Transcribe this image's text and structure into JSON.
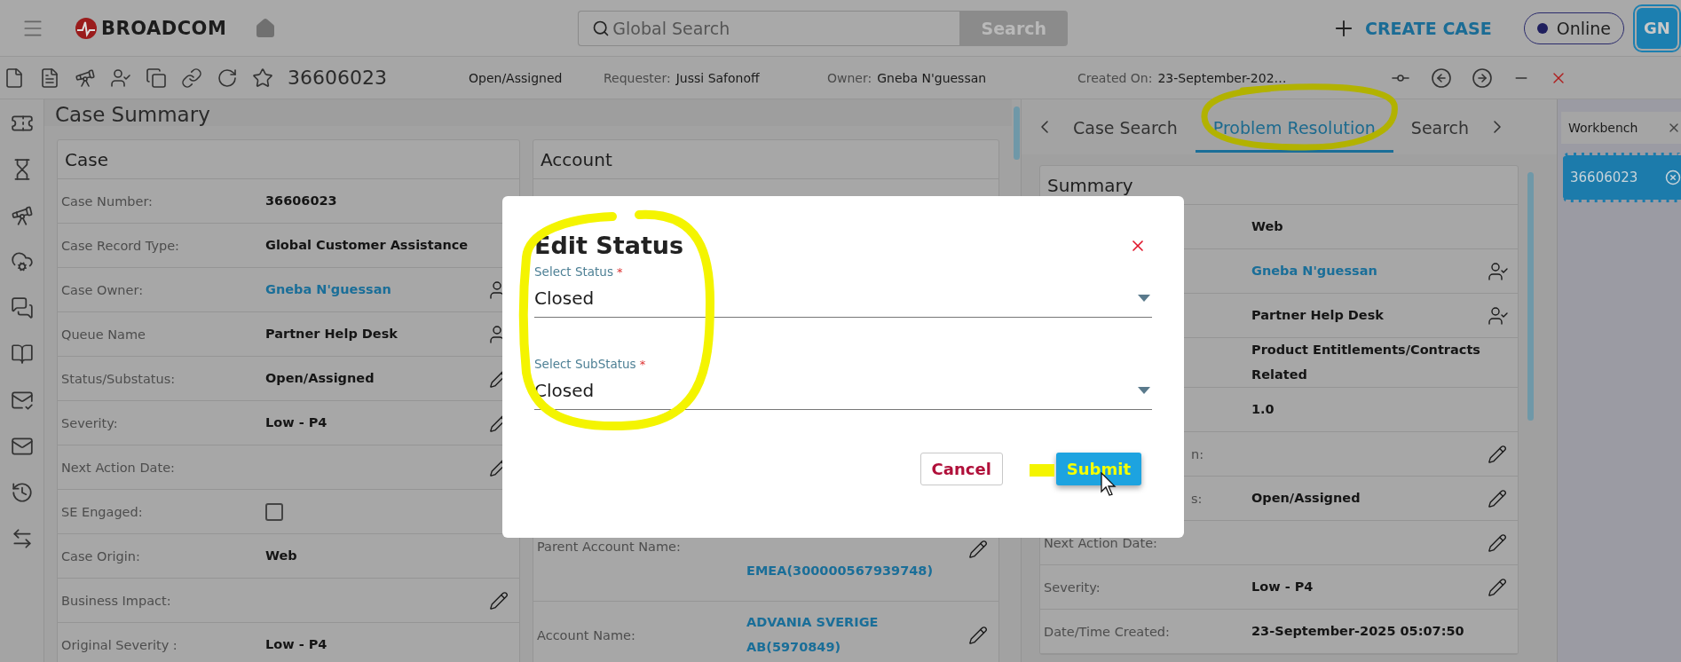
{
  "topbar": {
    "brand": "BROADCOM",
    "search": {
      "placeholder": "Global Search"
    },
    "search_button": "Search",
    "create_case": "CREATE CASE",
    "presence": "Online",
    "avatar": "GN"
  },
  "case_bar": {
    "case_number": "36606023",
    "status": "Open/Assigned",
    "fields": [
      {
        "label": "Requester:",
        "value": "Jussi Safonoff"
      },
      {
        "label": "Owner:",
        "value": "Gneba N'guessan"
      },
      {
        "label": "Created On:",
        "value": "23-September-202…"
      }
    ]
  },
  "case_summary": {
    "title": "Case Summary",
    "case_card": {
      "title": "Case",
      "rows": [
        {
          "kind": "text",
          "label": "Case Number:",
          "value": "36606023"
        },
        {
          "kind": "text",
          "label": "Case Record Type:",
          "value": "Global Customer Assistance"
        },
        {
          "kind": "link",
          "label": "Case Owner:",
          "value": "Gneba N'guessan",
          "action": {
            "kind": "reassign"
          }
        },
        {
          "kind": "text",
          "label": "Queue Name",
          "value": "Partner Help Desk",
          "action": {
            "kind": "reassign"
          }
        },
        {
          "kind": "text",
          "label": "Status/Substatus:",
          "value": "Open/Assigned",
          "action": {
            "kind": "edit"
          }
        },
        {
          "kind": "text",
          "label": "Severity:",
          "value": "Low - P4",
          "action": {
            "kind": "edit"
          }
        },
        {
          "kind": "text",
          "label": "Next Action Date:",
          "action": {
            "kind": "edit"
          }
        },
        {
          "kind": "checkbox",
          "label": "SE Engaged:",
          "checked": false
        },
        {
          "kind": "text",
          "label": "Case Origin:",
          "value": "Web"
        },
        {
          "kind": "text",
          "label": "Business Impact:",
          "action": {
            "kind": "edit"
          }
        },
        {
          "kind": "text",
          "label": "Original Severity :",
          "value": "Low - P4"
        }
      ]
    },
    "account_card": {
      "title": "Account",
      "rows": [
        {
          "kind": "link",
          "label": "Parent Account Name:",
          "value": "EMEA(300000567939748)",
          "action": {
            "kind": "edit"
          }
        },
        {
          "kind": "link",
          "label": "Account Name:",
          "value": "ADVANIA SVERIGE AB(5970849)",
          "action": {
            "kind": "edit"
          }
        }
      ]
    }
  },
  "right_panel": {
    "tabs": [
      {
        "label": "Case Search",
        "selected": false
      },
      {
        "label": "Problem Resolution",
        "selected": true
      },
      {
        "label": "Search",
        "selected": false
      }
    ],
    "summary": {
      "title": "Summary",
      "rows": [
        {
          "kind": "text",
          "value": "Web"
        },
        {
          "kind": "link",
          "value": "Gneba N'guessan",
          "action": {
            "kind": "reassign"
          }
        },
        {
          "kind": "text",
          "value": "Partner Help Desk",
          "action": {
            "kind": "reassign"
          }
        },
        {
          "kind": "text",
          "value": "Product Entitlements/Contracts Related"
        },
        {
          "kind": "text",
          "value": "1.0"
        },
        {
          "kind": "text",
          "label": "n:",
          "covered": true,
          "action": {
            "kind": "edit"
          }
        },
        {
          "kind": "text",
          "label": "s:",
          "covered": true,
          "value": "Open/Assigned",
          "action": {
            "kind": "edit"
          }
        },
        {
          "kind": "text",
          "label": "Next Action Date:",
          "action": {
            "kind": "edit"
          }
        },
        {
          "kind": "text",
          "label": "Severity:",
          "value": "Low - P4",
          "action": {
            "kind": "edit"
          }
        },
        {
          "kind": "text",
          "label": "Date/Time Created:",
          "value": "23-September-2025 05:07:50"
        }
      ]
    }
  },
  "workbench": {
    "title": "Workbench",
    "items": [
      {
        "label": "36606023",
        "selected": true
      }
    ]
  },
  "dialog": {
    "title": "Edit Status",
    "fields": [
      {
        "label": "Select Status",
        "required_mark": "*",
        "value": "Closed"
      },
      {
        "label": "Select SubStatus",
        "required_mark": "*",
        "value": "Closed"
      }
    ],
    "buttons": [
      {
        "label": "Cancel",
        "kind": "secondary"
      },
      {
        "label": "Submit",
        "kind": "primary"
      }
    ]
  }
}
